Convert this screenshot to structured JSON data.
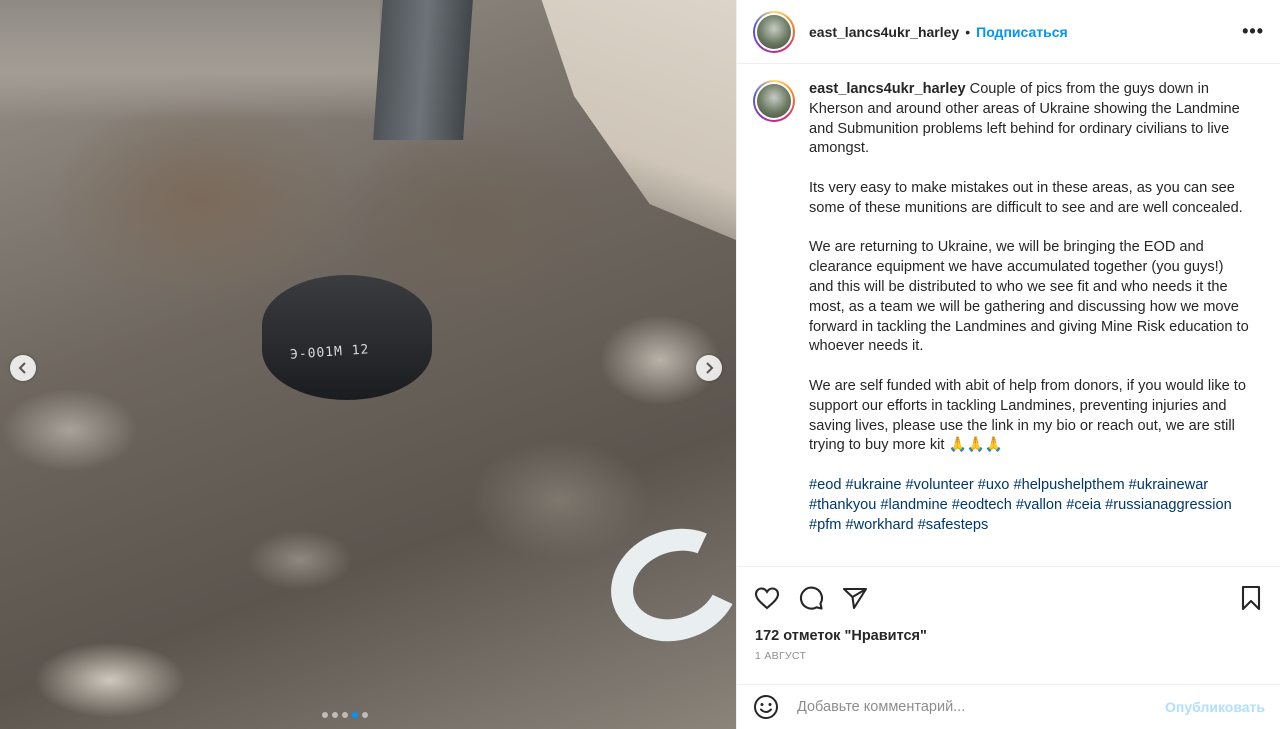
{
  "post": {
    "username": "east_lancs4ukr_harley",
    "separator": "•",
    "follow_label": "Подписаться",
    "more_label": "•••",
    "image_mine_marking": "Э-001М 12",
    "carousel": {
      "total": 5,
      "active_index": 3
    }
  },
  "caption": {
    "username": "east_lancs4ukr_harley",
    "paragraphs": [
      "Couple of pics from the guys down in Kherson and around other areas of Ukraine showing the Landmine and Submunition problems left behind for ordinary civilians to live amongst.",
      "Its very easy to make mistakes out in these areas, as you can see some of these munitions are difficult to see and are well concealed.",
      "We are returning to Ukraine, we will be bringing the EOD and clearance equipment we have accumulated together (you guys!) and this will be distributed to who we see fit and who needs it the most, as a team we will be gathering and discussing how we move forward in tackling the Landmines and giving Mine Risk education to whoever needs it.",
      "We are self funded with abit of help from donors, if you would like to support our efforts in tackling Landmines, preventing injuries and saving lives, please use the link in my bio or reach out, we are still trying to buy more kit 🙏🙏🙏"
    ],
    "hashtags": "#eod #ukraine #volunteer #uxo #helpushelpthem #ukrainewar #thankyou #landmine #eodtech #vallon #ceia #russianaggression #pfm #workhard #safesteps"
  },
  "actions": {
    "like_icon": "heart-icon",
    "comment_icon": "comment-icon",
    "share_icon": "paper-plane-icon",
    "save_icon": "bookmark-icon"
  },
  "likes_text": "172 отметок \"Нравится\"",
  "date_text": "1 АВГУСТ",
  "comment": {
    "placeholder": "Добавьте комментарий...",
    "publish_label": "Опубликовать",
    "emoji_icon": "smiley-icon"
  },
  "colors": {
    "link_blue": "#0095f6",
    "hashtag_blue": "#00376b",
    "publish_disabled": "#b2dffc"
  }
}
